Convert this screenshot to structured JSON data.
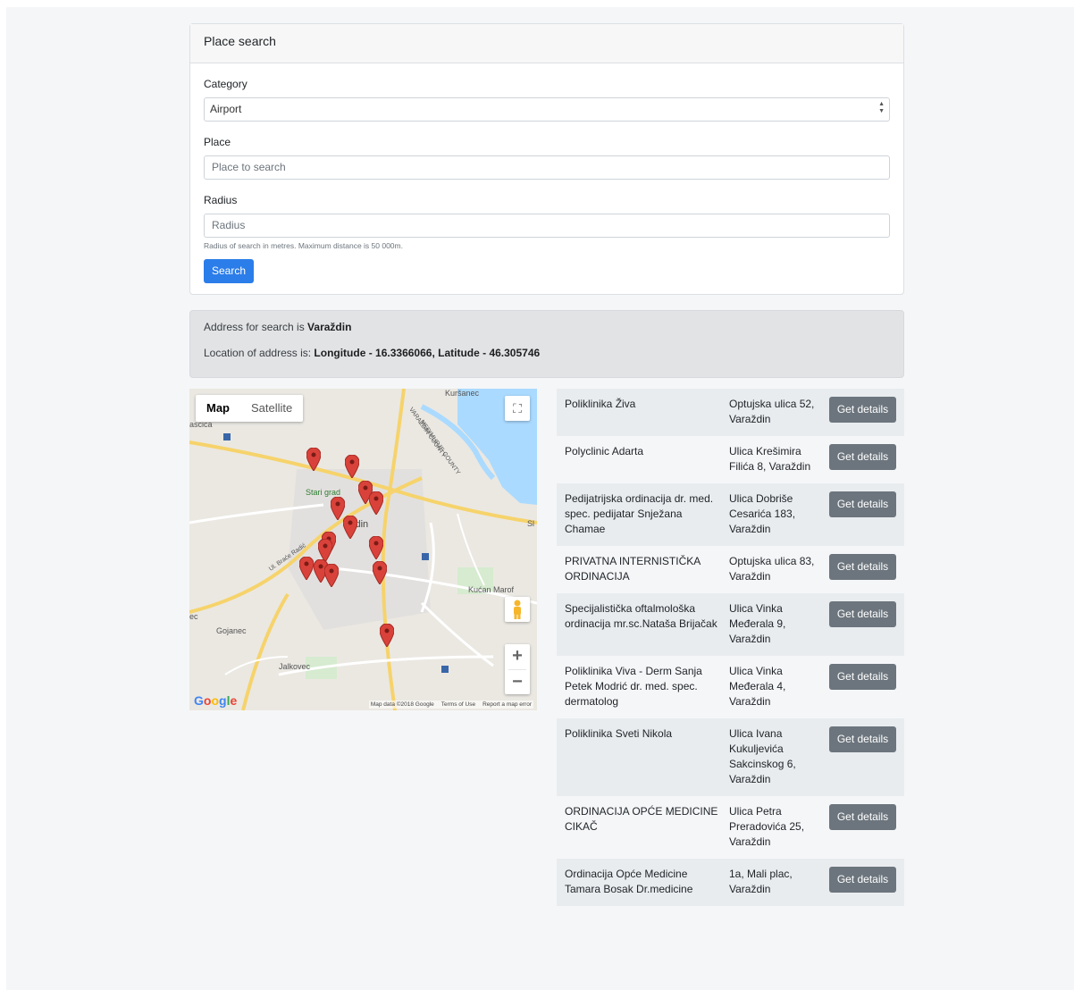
{
  "form": {
    "title": "Place search",
    "category_label": "Category",
    "category_value": "Airport",
    "place_label": "Place",
    "place_placeholder": "Place to search",
    "radius_label": "Radius",
    "radius_placeholder": "Radius",
    "radius_help": "Radius of search in metres. Maximum distance is 50 000m.",
    "search_button": "Search"
  },
  "address": {
    "prefix": "Address for search is ",
    "name": "Varaždin",
    "location_prefix": "Location of address is: ",
    "location": "Longitude - 16.3366066, Latitude - 46.305746"
  },
  "map": {
    "type_map": "Map",
    "type_satellite": "Satellite",
    "labels": {
      "kursanec": "Kuršanec",
      "mesicica": "ascica",
      "medimurje": "MEĐIMURJE COUNTY",
      "varazdin_county": "VARAŽDIN COUNTY",
      "stari_grad": "Stari grad",
      "varazdin": "ždin",
      "kucan": "Kućan Marof",
      "gojanec": "Gojanec",
      "jalkovec": "Jalkovec",
      "ec": "ec",
      "brace_radic": "Ul. Braće Radić",
      "si": "Sl"
    },
    "footer_data": "Map data ©2018 Google",
    "footer_terms": "Terms of Use",
    "footer_report": "Report a map error",
    "logo": "Google",
    "zoom_in": "+",
    "zoom_out": "−"
  },
  "results": [
    {
      "name": "Poliklinika Živa",
      "address": "Optujska ulica 52, Varaždin",
      "button": "Get details"
    },
    {
      "name": "Polyclinic Adarta",
      "address": "Ulica Krešimira Filića 8, Varaždin",
      "button": "Get details"
    },
    {
      "name": "Pedijatrijska ordinacija dr. med. spec. pedijatar Snježana Chamae",
      "address": "Ulica Dobriše Cesarića 183, Varaždin",
      "button": "Get details"
    },
    {
      "name": "PRIVATNA INTERNISTIČKA ORDINACIJA",
      "address": "Optujska ulica 83, Varaždin",
      "button": "Get details"
    },
    {
      "name": "Specijalistička oftalmološka ordinacija mr.sc.Nataša Brijačak",
      "address": "Ulica Vinka Međerala 9, Varaždin",
      "button": "Get details"
    },
    {
      "name": "Poliklinika Viva - Derm Sanja Petek Modrić dr. med. spec. dermatolog",
      "address": "Ulica Vinka Međerala 4, Varaždin",
      "button": "Get details"
    },
    {
      "name": "Poliklinika Sveti Nikola",
      "address": "Ulica Ivana Kukuljevića Sakcinskog 6, Varaždin",
      "button": "Get details"
    },
    {
      "name": "ORDINACIJA OPĆE MEDICINE CIKAČ",
      "address": "Ulica Petra Preradovića 25, Varaždin",
      "button": "Get details"
    },
    {
      "name": "Ordinacija Opće Medicine Tamara Bosak Dr.medicine",
      "address": "1a, Mali plac, Varaždin",
      "button": "Get details"
    }
  ],
  "colors": {
    "primary": "#2b7de9",
    "secondary": "#6c757d",
    "pin": "#d9423a",
    "water": "#aadaff"
  }
}
